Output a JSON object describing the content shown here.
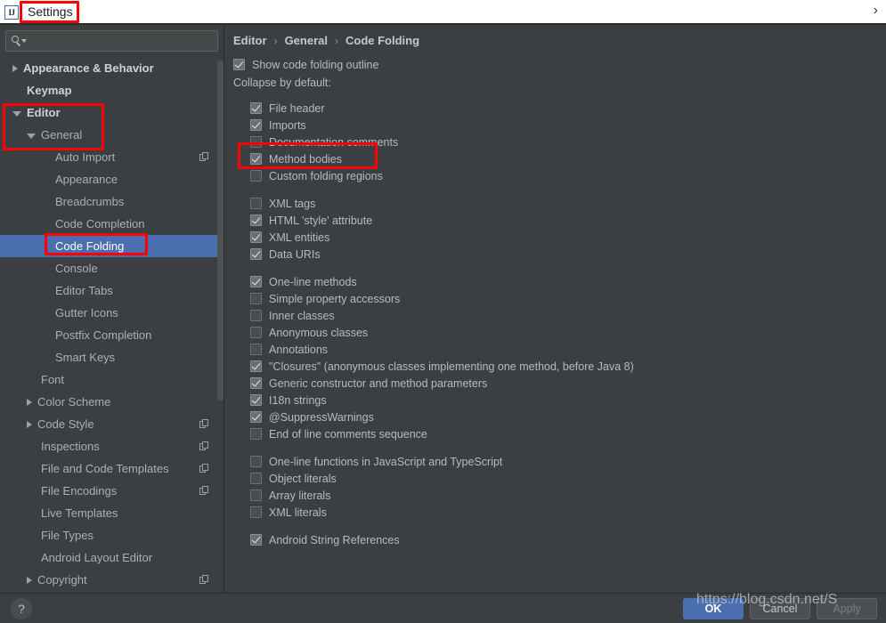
{
  "window": {
    "title": "Settings",
    "logo_text": "IJ",
    "expand_chevron": "›"
  },
  "sidebar": {
    "search": {
      "placeholder": "",
      "value": "",
      "icon": "search-icon"
    },
    "items": [
      {
        "label": "Appearance & Behavior",
        "indent": 0,
        "arrow": "right",
        "bold": true,
        "selected": false,
        "copy": false
      },
      {
        "label": "Keymap",
        "indent": 1,
        "arrow": "none",
        "bold": true,
        "selected": false,
        "copy": false
      },
      {
        "label": "Editor",
        "indent": 0,
        "arrow": "down",
        "bold": true,
        "selected": false,
        "copy": false
      },
      {
        "label": "General",
        "indent": 1,
        "arrow": "down",
        "bold": false,
        "selected": false,
        "copy": false
      },
      {
        "label": "Auto Import",
        "indent": 3,
        "arrow": "none",
        "bold": false,
        "selected": false,
        "copy": true
      },
      {
        "label": "Appearance",
        "indent": 3,
        "arrow": "none",
        "bold": false,
        "selected": false,
        "copy": false
      },
      {
        "label": "Breadcrumbs",
        "indent": 3,
        "arrow": "none",
        "bold": false,
        "selected": false,
        "copy": false
      },
      {
        "label": "Code Completion",
        "indent": 3,
        "arrow": "none",
        "bold": false,
        "selected": false,
        "copy": false
      },
      {
        "label": "Code Folding",
        "indent": 3,
        "arrow": "none",
        "bold": false,
        "selected": true,
        "copy": false
      },
      {
        "label": "Console",
        "indent": 3,
        "arrow": "none",
        "bold": false,
        "selected": false,
        "copy": false
      },
      {
        "label": "Editor Tabs",
        "indent": 3,
        "arrow": "none",
        "bold": false,
        "selected": false,
        "copy": false
      },
      {
        "label": "Gutter Icons",
        "indent": 3,
        "arrow": "none",
        "bold": false,
        "selected": false,
        "copy": false
      },
      {
        "label": "Postfix Completion",
        "indent": 3,
        "arrow": "none",
        "bold": false,
        "selected": false,
        "copy": false
      },
      {
        "label": "Smart Keys",
        "indent": 3,
        "arrow": "none",
        "bold": false,
        "selected": false,
        "copy": false
      },
      {
        "label": "Font",
        "indent": 2,
        "arrow": "none",
        "bold": false,
        "selected": false,
        "copy": false
      },
      {
        "label": "Color Scheme",
        "indent": 1,
        "arrow": "right",
        "bold": false,
        "selected": false,
        "copy": false
      },
      {
        "label": "Code Style",
        "indent": 1,
        "arrow": "right",
        "bold": false,
        "selected": false,
        "copy": true
      },
      {
        "label": "Inspections",
        "indent": 2,
        "arrow": "none",
        "bold": false,
        "selected": false,
        "copy": true
      },
      {
        "label": "File and Code Templates",
        "indent": 2,
        "arrow": "none",
        "bold": false,
        "selected": false,
        "copy": true
      },
      {
        "label": "File Encodings",
        "indent": 2,
        "arrow": "none",
        "bold": false,
        "selected": false,
        "copy": true
      },
      {
        "label": "Live Templates",
        "indent": 2,
        "arrow": "none",
        "bold": false,
        "selected": false,
        "copy": false
      },
      {
        "label": "File Types",
        "indent": 2,
        "arrow": "none",
        "bold": false,
        "selected": false,
        "copy": false
      },
      {
        "label": "Android Layout Editor",
        "indent": 2,
        "arrow": "none",
        "bold": false,
        "selected": false,
        "copy": false
      },
      {
        "label": "Copyright",
        "indent": 1,
        "arrow": "right",
        "bold": false,
        "selected": false,
        "copy": true
      }
    ]
  },
  "main": {
    "breadcrumb": [
      "Editor",
      "General",
      "Code Folding"
    ],
    "breadcrumb_separator": "›",
    "show_outline": {
      "label": "Show code folding outline",
      "checked": true
    },
    "collapse_label": "Collapse by default:",
    "groups": [
      {
        "name": "java-structure",
        "options": [
          {
            "label": "File header",
            "checked": true
          },
          {
            "label": "Imports",
            "checked": true
          },
          {
            "label": "Documentation comments",
            "checked": false
          },
          {
            "label": "Method bodies",
            "checked": true
          },
          {
            "label": "Custom folding regions",
            "checked": false
          }
        ]
      },
      {
        "name": "xml-html",
        "options": [
          {
            "label": "XML tags",
            "checked": false
          },
          {
            "label": "HTML 'style' attribute",
            "checked": true
          },
          {
            "label": "XML entities",
            "checked": true
          },
          {
            "label": "Data URIs",
            "checked": true
          }
        ]
      },
      {
        "name": "members",
        "options": [
          {
            "label": "One-line methods",
            "checked": true
          },
          {
            "label": "Simple property accessors",
            "checked": false
          },
          {
            "label": "Inner classes",
            "checked": false
          },
          {
            "label": "Anonymous classes",
            "checked": false
          },
          {
            "label": "Annotations",
            "checked": false
          },
          {
            "label": "\"Closures\" (anonymous classes implementing one method, before Java 8)",
            "checked": true
          },
          {
            "label": "Generic constructor and method parameters",
            "checked": true
          },
          {
            "label": "I18n strings",
            "checked": true
          },
          {
            "label": "@SuppressWarnings",
            "checked": true
          },
          {
            "label": "End of line comments sequence",
            "checked": false
          }
        ]
      },
      {
        "name": "javascript",
        "options": [
          {
            "label": "One-line functions in JavaScript and TypeScript",
            "checked": false
          },
          {
            "label": "Object literals",
            "checked": false
          },
          {
            "label": "Array literals",
            "checked": false
          },
          {
            "label": "XML literals",
            "checked": false
          }
        ]
      },
      {
        "name": "android",
        "options": [
          {
            "label": "Android String References",
            "checked": true
          }
        ]
      }
    ]
  },
  "footer": {
    "help_glyph": "?",
    "buttons": [
      {
        "label": "OK",
        "style": "primary"
      },
      {
        "label": "Cancel",
        "style": "normal"
      },
      {
        "label": "Apply",
        "style": "disabled"
      }
    ]
  },
  "watermark": {
    "text": "https://blog.csdn.net/S"
  },
  "annotations": {
    "color": "#ff0000",
    "boxes": [
      "title-settings",
      "editor-general",
      "code-folding-item",
      "method-bodies"
    ]
  }
}
